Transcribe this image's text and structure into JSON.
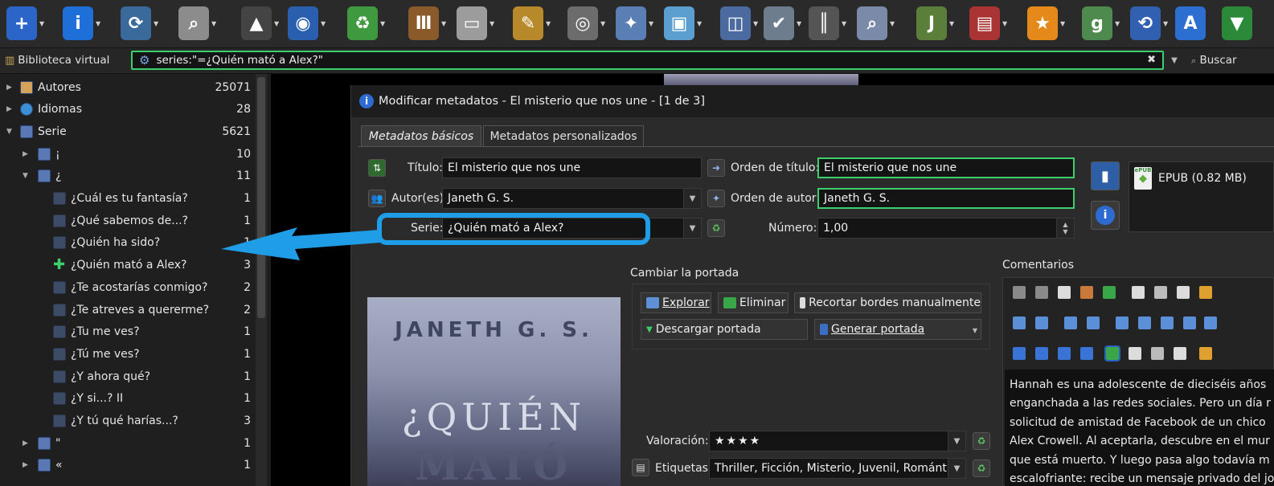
{
  "toolbar": {
    "buttons": [
      {
        "name": "add-books-icon",
        "color": "#2b65c7",
        "glyph": "+"
      },
      {
        "name": "edit-metadata-icon",
        "color": "#1f6fd8",
        "glyph": "i"
      },
      {
        "name": "convert-books-icon",
        "color": "#3a6a9c",
        "glyph": "⟳"
      },
      {
        "name": "view-icon",
        "color": "#8c8c8c",
        "glyph": "⌕"
      },
      {
        "name": "select-pointer-icon",
        "color": "#444",
        "glyph": "▲"
      },
      {
        "name": "get-books-icon",
        "color": "#2a5fb0",
        "glyph": "◉"
      },
      {
        "name": "fetch-news-icon",
        "color": "#3f9a3f",
        "glyph": "♻"
      },
      {
        "name": "library-icon",
        "color": "#8b5a2b",
        "glyph": "Ⅲ"
      },
      {
        "name": "device-icon",
        "color": "#9c9c9c",
        "glyph": "▭"
      },
      {
        "name": "edit-book-icon",
        "color": "#b8892a",
        "glyph": "✎"
      },
      {
        "name": "connect-share-icon",
        "color": "#6c6c6c",
        "glyph": "◎"
      },
      {
        "name": "preferences-icon",
        "color": "#5a7fb5",
        "glyph": "✦"
      },
      {
        "name": "plugins-icon",
        "color": "#5a9fd0",
        "glyph": "▣"
      },
      {
        "name": "quality-check-icon",
        "color": "#4a6aa0",
        "glyph": "◫"
      },
      {
        "name": "database-check-icon",
        "color": "#6d7d8d",
        "glyph": "✔"
      },
      {
        "name": "barcode-add-icon",
        "color": "#555",
        "glyph": "║"
      },
      {
        "name": "find-duplicates-icon",
        "color": "#7a8aa8",
        "glyph": "⌕"
      },
      {
        "name": "jpeg-cover-icon",
        "color": "#5b7e3a",
        "glyph": "J"
      },
      {
        "name": "books-stack-icon",
        "color": "#a33",
        "glyph": "▤"
      },
      {
        "name": "rating-icon",
        "color": "#e58a1a",
        "glyph": "★"
      },
      {
        "name": "goodreads-icon",
        "color": "#4e8a4e",
        "glyph": "g"
      },
      {
        "name": "sync-icon",
        "color": "#3160b0",
        "glyph": "⟲"
      },
      {
        "name": "sort-az-icon",
        "color": "#2c6fd0",
        "glyph": "A"
      },
      {
        "name": "more-icon",
        "color": "#2a8a3a",
        "glyph": "▼"
      }
    ]
  },
  "search": {
    "virtual_library": "Biblioteca virtual",
    "query": "series:\"=¿Quién mató a Alex?\"",
    "search_button": "Buscar"
  },
  "tag_browser": {
    "rows": [
      {
        "label": "Autores",
        "count": "25071"
      },
      {
        "label": "Idiomas",
        "count": "28"
      },
      {
        "label": "Serie",
        "count": "5621"
      },
      {
        "label": "¡",
        "count": "10"
      },
      {
        "label": "¿",
        "count": "11"
      },
      {
        "label": "¿Cuál es tu fantasía?",
        "count": "1"
      },
      {
        "label": "¿Qué sabemos de...?",
        "count": "1"
      },
      {
        "label": "¿Quién ha sido?",
        "count": "1"
      },
      {
        "label": "¿Quién mató a Alex?",
        "count": "3"
      },
      {
        "label": "¿Te acostarías conmigo?",
        "count": "2"
      },
      {
        "label": "¿Te atreves a quererme?",
        "count": "2"
      },
      {
        "label": "¿Tu me ves?",
        "count": "1"
      },
      {
        "label": "¿Tú me ves?",
        "count": "1"
      },
      {
        "label": "¿Y ahora qué?",
        "count": "1"
      },
      {
        "label": "¿Y si...? II",
        "count": "1"
      },
      {
        "label": "¿Y tú qué harías...?",
        "count": "3"
      },
      {
        "label": "\"",
        "count": "1"
      },
      {
        "label": "«",
        "count": "1"
      }
    ]
  },
  "dialog": {
    "title": "Modificar metadatos - El misterio que nos une -  [1 de 3]",
    "tab_basic": "Metadatos básicos",
    "tab_custom": "Metadatos personalizados",
    "title_label": "Título:",
    "title_value": "El misterio que nos une",
    "title_sort_label": "Orden de título:",
    "title_sort_value": "El misterio que nos une",
    "authors_label": "Autor(es)",
    "authors_value": "Janeth G. S.",
    "author_sort_label": "Orden de autor:",
    "author_sort_value": "Janeth G. S.",
    "series_label": "Serie:",
    "series_value": "¿Quién mató a Alex?",
    "number_label": "Número:",
    "number_value": "1,00",
    "format_label": "EPUB (0.82 MB)",
    "format_badge": "ePUB",
    "change_cover": "Cambiar la portada",
    "browse": "Explorar",
    "remove": "Eliminar",
    "trim": "Recortar bordes manualmente",
    "download_cover": "Descargar portada",
    "generate_cover": "Generar portada",
    "rating_label": "Valoración:",
    "rating_value": "★★★★",
    "tags_label": "Etiquetas:",
    "tags_value": "Thriller, Ficción, Misterio, Juvenil, Romántica",
    "comments_label": "Comentarios",
    "comments_lines": [
      "Hannah es una adolescente de dieciséis años",
      "enganchada a las redes sociales. Pero un día r",
      "solicitud de amistad de Facebook de un chico",
      "Alex Crowell. Al aceptarla, descubre en el mur",
      "que está muerto. Y luego pasa algo todavía m",
      "escalofriante: recibe un mensaje privado del jo"
    ],
    "cover": {
      "author": "JANETH G. S.",
      "title_line1": "¿QUIÉN",
      "title_line2": "MATÓ"
    }
  },
  "colors": {
    "accent_green": "#3ccf6b",
    "highlight_blue": "#1f9de6",
    "background": "#1e1e1e"
  }
}
